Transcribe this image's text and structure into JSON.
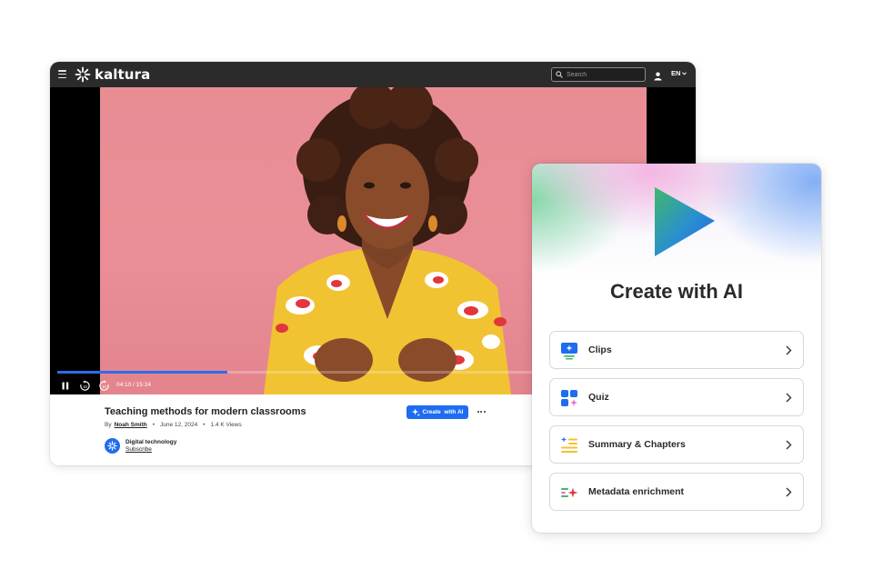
{
  "topbar": {
    "logo_text": "kaltura",
    "search_placeholder": "Search",
    "language": "EN"
  },
  "player": {
    "timecode": "04:10 / 15:24",
    "progress": 0.27,
    "accent_color": "#2e6bea"
  },
  "video": {
    "title": "Teaching methods for modern classrooms",
    "by_prefix": "By",
    "author": "Noah Smith",
    "date": "June 12, 2024",
    "views": "1.4 K Views",
    "create_button_label": "Create  with AI",
    "channel_name": "Digital technology",
    "subscribe_label": "Subscribe"
  },
  "ai_panel": {
    "title": "Create with AI",
    "options": [
      {
        "label": "Clips",
        "icon": "clips-icon"
      },
      {
        "label": "Quiz",
        "icon": "quiz-icon"
      },
      {
        "label": "Summary & Chapters",
        "icon": "summary-chapters-icon"
      },
      {
        "label": "Metadata enrichment",
        "icon": "metadata-enrichment-icon"
      }
    ]
  },
  "colors": {
    "brand_blue": "#1e6cf0",
    "topbar": "#2b2b2b",
    "video_background": "#e88d94"
  }
}
